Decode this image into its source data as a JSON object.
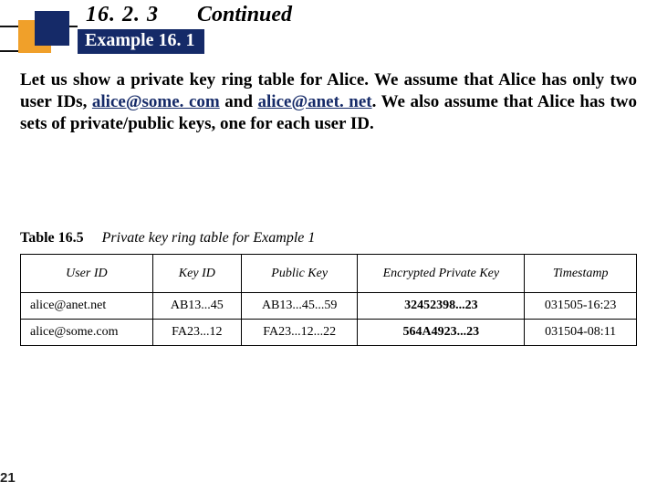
{
  "header": {
    "section_number": "16. 2. 3",
    "continued": "Continued",
    "example_label": "Example 16. 1"
  },
  "paragraph": {
    "pre1": "Let us show a private key ring table for Alice. We assume that Alice has only two user IDs, ",
    "link1": "alice@some. com",
    "mid": " and ",
    "link2": "alice@anet. net",
    "post": ". We also assume that Alice has two sets of private/public keys, one for each user ID."
  },
  "table": {
    "label_bold": "Table 16.5",
    "label_ital": "Private key ring table for Example 1",
    "headers": [
      "User ID",
      "Key ID",
      "Public Key",
      "Encrypted Private Key",
      "Timestamp"
    ],
    "rows": [
      {
        "cells": [
          "alice@anet.net",
          "AB13...45",
          "AB13...45...59",
          "32452398...23",
          "031505-16:23"
        ]
      },
      {
        "cells": [
          "alice@some.com",
          "FA23...12",
          "FA23...12...22",
          "564A4923...23",
          "031504-08:11"
        ]
      }
    ]
  },
  "page_number": "21"
}
